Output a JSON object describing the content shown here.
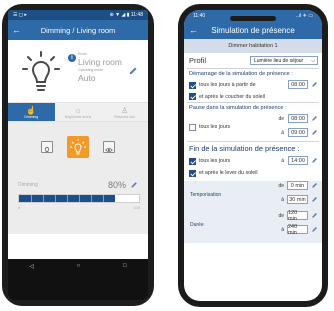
{
  "left_phone": {
    "status_bar": {
      "left": "☰ ◻ ▸",
      "right": "⊕ ▼ ◢ ▮ 11:48"
    },
    "app_bar": {
      "title": "Dimming / Living room"
    },
    "device": {
      "room_label": "Room",
      "room_value": "Living room",
      "mode_label": "Operating mode",
      "mode_value": "Auto"
    },
    "tabs": [
      {
        "label": "Dimming",
        "icon": "hand-icon",
        "active": true
      },
      {
        "label": "Brightness levels",
        "icon": "sun-icon",
        "active": false
      },
      {
        "label": "Presence sim.",
        "icon": "walk-icon",
        "active": false
      }
    ],
    "dimming": {
      "label": "Dimming",
      "value": "80%",
      "level": 0.8,
      "scale_min": "0",
      "scale_max": "100"
    },
    "nav": {
      "back": "◁",
      "home": "○",
      "recent": "□"
    },
    "colors": {
      "primary": "#2d6aa7",
      "accent": "#f29a28",
      "fill": "#1f4e8c"
    }
  },
  "right_phone": {
    "status_bar": {
      "time": "11:40",
      "right": "..ıl ✈ ▭"
    },
    "app_bar": {
      "title": "Simulation de présence"
    },
    "dimmer_name": "Dimmer habitation 1",
    "profile": {
      "label": "Profil",
      "value": "Lumière lieu de séjour"
    },
    "start": {
      "heading": "Démarrage de la simulation de présence :",
      "every_day": "tous les jours à partir de",
      "every_day_checked": true,
      "time": "08:00",
      "after_sunset": "et après le coucher du soleil",
      "after_sunset_checked": true
    },
    "pause": {
      "heading": "Pause dans la simulation de présence :",
      "every_day": "tous les jours",
      "every_day_checked": false,
      "from_label": "de",
      "from": "08:00",
      "to_label": "à",
      "to": "09:00"
    },
    "end": {
      "heading": "Fin de la simulation de présence :",
      "every_day": "tous les jours",
      "every_day_checked": true,
      "at_label": "à",
      "time": "14:00",
      "after_sunrise": "et après le lever du soleil",
      "after_sunrise_checked": true
    },
    "timing": {
      "tempo_label": "Temporisation",
      "tempo_from_label": "de",
      "tempo_from": "0 min",
      "tempo_to_label": "à",
      "tempo_to": "30 min",
      "duration_label": "Durée",
      "dur_from_label": "de",
      "dur_from": "120 min",
      "dur_to_label": "à",
      "dur_to": "240 min"
    }
  }
}
